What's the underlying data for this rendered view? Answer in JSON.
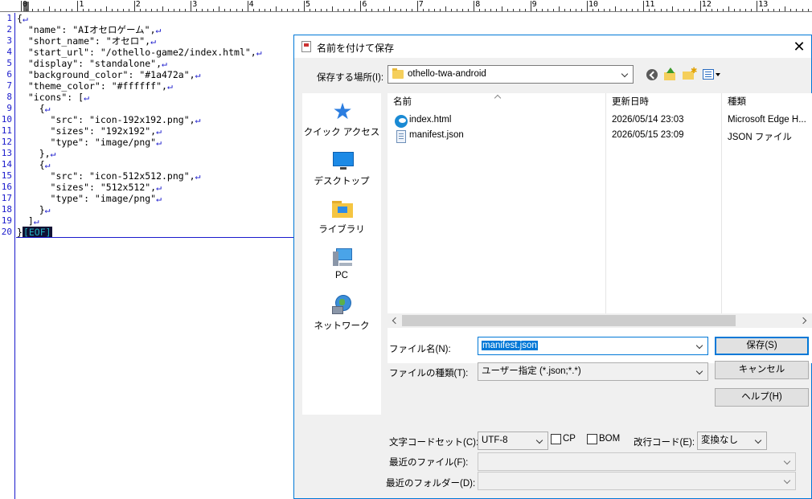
{
  "ruler": {
    "marks": [
      "0",
      "1",
      "2",
      "3",
      "4",
      "5",
      "6",
      "7",
      "8",
      "9",
      "10",
      "11",
      "12",
      "13"
    ]
  },
  "editor": {
    "line_numbers": [
      "1",
      "2",
      "3",
      "4",
      "5",
      "6",
      "7",
      "8",
      "9",
      "10",
      "11",
      "12",
      "13",
      "14",
      "15",
      "16",
      "17",
      "18",
      "19",
      "20"
    ],
    "lines": [
      "{",
      "  \"name\": \"AIオセロゲーム\",",
      "  \"short_name\": \"オセロ\",",
      "  \"start_url\": \"/othello-game2/index.html\",",
      "  \"display\": \"standalone\",",
      "  \"background_color\": \"#1a472a\",",
      "  \"theme_color\": \"#ffffff\",",
      "  \"icons\": [",
      "    {",
      "      \"src\": \"icon-192x192.png\",",
      "      \"sizes\": \"192x192\",",
      "      \"type\": \"image/png\"",
      "    },",
      "    {",
      "      \"src\": \"icon-512x512.png\",",
      "      \"sizes\": \"512x512\",",
      "      \"type\": \"image/png\"",
      "    }",
      "  ]",
      "}"
    ],
    "newline_mark": "↵",
    "eof_mark": "[EOF]"
  },
  "dialog": {
    "title": "名前を付けて保存",
    "close_glyph": "✕",
    "location_label": "保存する場所(I):",
    "location_value": "othello-twa-android",
    "places": [
      {
        "label": "クイック アクセス",
        "icon": "star-icon"
      },
      {
        "label": "デスクトップ",
        "icon": "desktop-icon"
      },
      {
        "label": "ライブラリ",
        "icon": "library-icon"
      },
      {
        "label": "PC",
        "icon": "pc-icon"
      },
      {
        "label": "ネットワーク",
        "icon": "network-icon"
      }
    ],
    "columns": {
      "name": "名前",
      "date": "更新日時",
      "type": "種類"
    },
    "files": [
      {
        "name": "index.html",
        "date": "2026/05/14 23:03",
        "type": "Microsoft Edge H...",
        "icon": "edge-icon"
      },
      {
        "name": "manifest.json",
        "date": "2026/05/15 23:09",
        "type": "JSON ファイル",
        "icon": "json-file-icon"
      }
    ],
    "filename_label": "ファイル名(N):",
    "filename_value": "manifest.json",
    "filetype_label": "ファイルの種類(T):",
    "filetype_value": "ユーザー指定 (*.json;*.*)",
    "save_button": "保存(S)",
    "cancel_button": "キャンセル",
    "help_button": "ヘルプ(H)",
    "charset_label": "文字コードセット(C):",
    "charset_value": "UTF-8",
    "cp_label": "CP",
    "bom_label": "BOM",
    "newline_label": "改行コード(E):",
    "newline_value": "変換なし",
    "recent_file_label": "最近のファイル(F):",
    "recent_folder_label": "最近のフォルダー(D):",
    "accent_color": "#0078d7"
  }
}
